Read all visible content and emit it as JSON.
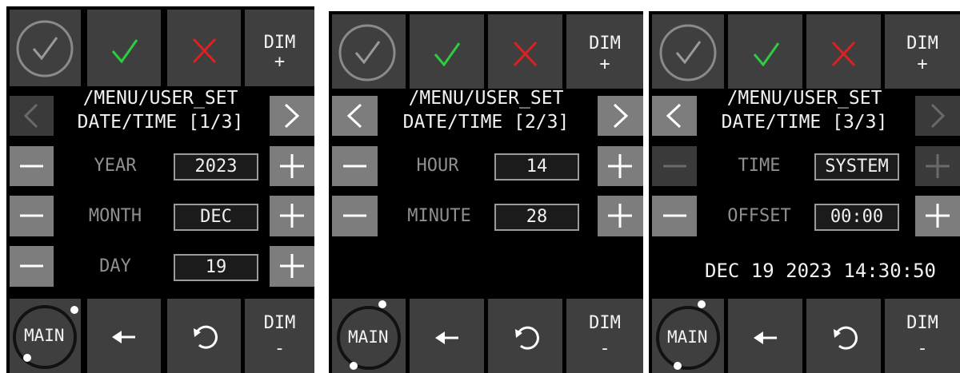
{
  "panels": [
    {
      "path": "/MENU/USER_SET",
      "subtitle": "DATE/TIME [1/3]",
      "rows": [
        {
          "label": "YEAR",
          "value": "2023"
        },
        {
          "label": "MONTH",
          "value": "DEC"
        },
        {
          "label": "DAY",
          "value": "19"
        }
      ]
    },
    {
      "path": "/MENU/USER_SET",
      "subtitle": "DATE/TIME [2/3]",
      "rows": [
        {
          "label": "HOUR",
          "value": "14"
        },
        {
          "label": "MINUTE",
          "value": "28"
        }
      ]
    },
    {
      "path": "/MENU/USER_SET",
      "subtitle": "DATE/TIME [3/3]",
      "rows": [
        {
          "label": "TIME",
          "value": "SYSTEM"
        },
        {
          "label": "OFFSET",
          "value": "00:00"
        }
      ],
      "clock": "DEC 19 2023 14:30:50"
    }
  ],
  "toolbar": {
    "dim_plus_top": "DIM",
    "dim_plus_bottom": "+",
    "dim_minus_top": "DIM",
    "dim_minus_bottom": "-",
    "main_label": "MAIN"
  },
  "icons": {
    "accept_circle": "circle-check-icon",
    "confirm": "check-icon",
    "cancel": "close-icon",
    "prev": "chevron-left-icon",
    "next": "chevron-right-icon",
    "decrement": "minus-icon",
    "increment": "plus-icon",
    "back": "arrow-left-icon",
    "refresh": "refresh-icon"
  },
  "colors": {
    "background": "#000000",
    "tile": "#3f3f3f",
    "tile_enabled": "#7d7d7d",
    "check_green": "#2ecc40",
    "cancel_red": "#e02020",
    "label_gray": "#8f8f8f"
  }
}
